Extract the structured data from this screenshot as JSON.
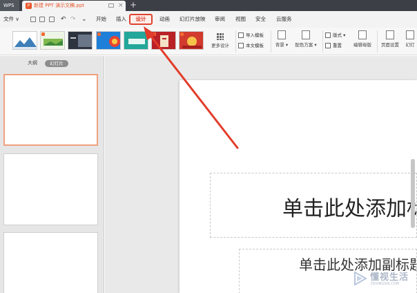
{
  "colors": {
    "accent": "#e0432f",
    "ppt_orange": "#e8572c",
    "titlebar_bg": "#3c3f45"
  },
  "titlebar": {
    "app_name": "WPS",
    "doc_tab_title": "新建 PPT 演示文稿.ppt",
    "close_glyph": "×",
    "new_tab_glyph": "+"
  },
  "menu": {
    "file_label": "文件 ∨",
    "undo_glyph": "↶",
    "redo_glyph": "↷",
    "more_glyph": "⌄",
    "items": [
      "开始",
      "插入",
      "设计",
      "动画",
      "幻灯片放映",
      "审阅",
      "视图",
      "安全",
      "云服务"
    ],
    "active_item": "设计"
  },
  "ribbon": {
    "more_designs_label": "更多设计",
    "import_template_label": "导入模板",
    "this_doc_template_label": "本文模板",
    "background_label": "背景 ▾",
    "color_scheme_label": "配色方案 ▾",
    "layout_label": "版式 ▾",
    "reset_label": "重置",
    "edit_master_label": "编辑母版",
    "page_setup_label": "页面设置",
    "slideshow_label": "幻灯",
    "template_icons": [
      "mountain-design",
      "green-landscape-design",
      "dark-photo-design",
      "blue-tech-design",
      "teal-design",
      "red-chinese-design",
      "red-festival-design"
    ]
  },
  "left_panel": {
    "outline_tab": "大纲",
    "slides_tab": "幻灯片"
  },
  "slide": {
    "title_placeholder": "单击此处添加标题",
    "subtitle_placeholder": "单击此处添加副标题"
  },
  "watermark": {
    "name": "懂视生活",
    "domain": "DDONGSHI.COM"
  }
}
